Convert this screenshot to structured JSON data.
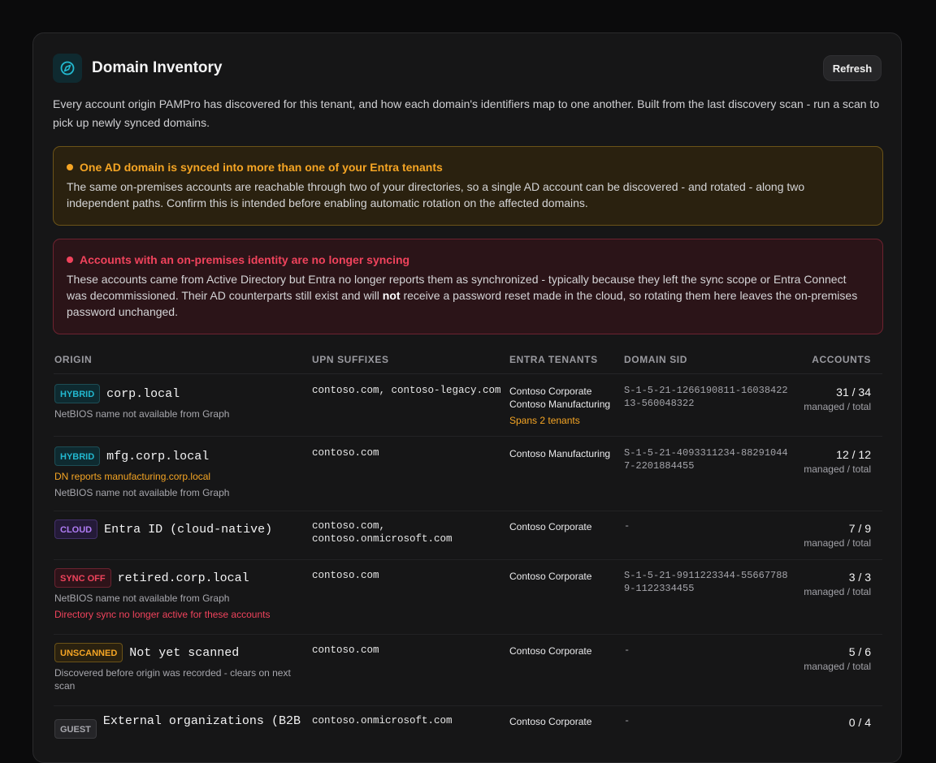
{
  "header": {
    "title": "Domain Inventory",
    "refresh_label": "Refresh",
    "logo_icon": "globe-compass-icon",
    "accent_color": "#22b8cf"
  },
  "intro": "Every account origin PAMPro has discovered for this tenant, and how each domain's identifiers map to one another. Built from the last discovery scan - run a scan to pick up newly synced domains.",
  "alerts": {
    "multi_tenant": {
      "title": "One AD domain is synced into more than one of your Entra tenants",
      "body": "The same on-premises accounts are reachable through two of your directories, so a single AD account can be discovered - and rotated - along two independent paths. Confirm this is intended before enabling automatic rotation on the affected domains.",
      "color": "#f5a524"
    },
    "sync_stopped": {
      "title": "Accounts with an on-premises identity are no longer syncing",
      "body_before": "These accounts came from Active Directory but Entra no longer reports them as synchronized - typically because they left the sync scope or Entra Connect was decommissioned. Their AD counterparts still exist and will ",
      "body_bold": "not",
      "body_after": " receive a password reset made in the cloud, so rotating them here leaves the on-premises password unchanged.",
      "color": "#f0435c"
    }
  },
  "table": {
    "columns": {
      "origin": "ORIGIN",
      "upn": "UPN SUFFIXES",
      "tenants": "ENTRA TENANTS",
      "sid": "DOMAIN SID",
      "accounts": "ACCOUNTS"
    },
    "accounts_label": "managed / total",
    "rows": [
      {
        "badge": "HYBRID",
        "domain": "corp.local",
        "notes": [
          "NetBIOS name not available from Graph"
        ],
        "upn": "contoso.com, contoso-legacy.com",
        "tenants": [
          "Contoso Corporate",
          "Contoso Manufacturing"
        ],
        "tenants_note": "Spans 2 tenants",
        "sid_line1": "S-1-5-21-1266190811-16038422",
        "sid_line2": "13-560048322",
        "accounts": "31 / 34"
      },
      {
        "badge": "HYBRID",
        "domain": "mfg.corp.local",
        "warn_note": "DN reports manufacturing.corp.local",
        "notes": [
          "NetBIOS name not available from Graph"
        ],
        "upn": "contoso.com",
        "tenants": [
          "Contoso Manufacturing"
        ],
        "sid_line1": "S-1-5-21-4093311234-88291044",
        "sid_line2": "7-2201884455",
        "accounts": "12 / 12"
      },
      {
        "badge": "CLOUD",
        "domain": "Entra ID (cloud-native)",
        "upn_line1": "contoso.com,",
        "upn_line2": "contoso.onmicrosoft.com",
        "tenants": [
          "Contoso Corporate"
        ],
        "sid_line1": "-",
        "accounts": "7 / 9"
      },
      {
        "badge": "SYNC OFF",
        "domain": "retired.corp.local",
        "notes": [
          "NetBIOS name not available from Graph"
        ],
        "err_note": "Directory sync no longer active for these accounts",
        "upn": "contoso.com",
        "tenants": [
          "Contoso Corporate"
        ],
        "sid_line1": "S-1-5-21-9911223344-55667788",
        "sid_line2": "9-1122334455",
        "accounts": "3 / 3"
      },
      {
        "badge": "UNSCANNED",
        "domain": "Not yet scanned",
        "notes": [
          "Discovered before origin was recorded - clears on next",
          "scan"
        ],
        "upn": "contoso.com",
        "tenants": [
          "Contoso Corporate"
        ],
        "sid_line1": "-",
        "accounts": "5 / 6"
      },
      {
        "badge": "GUEST",
        "domain": "External organizations (B2B",
        "upn": "contoso.onmicrosoft.com",
        "tenants": [
          "Contoso Corporate"
        ],
        "sid_line1": "-",
        "accounts": "0 / 4"
      }
    ]
  }
}
